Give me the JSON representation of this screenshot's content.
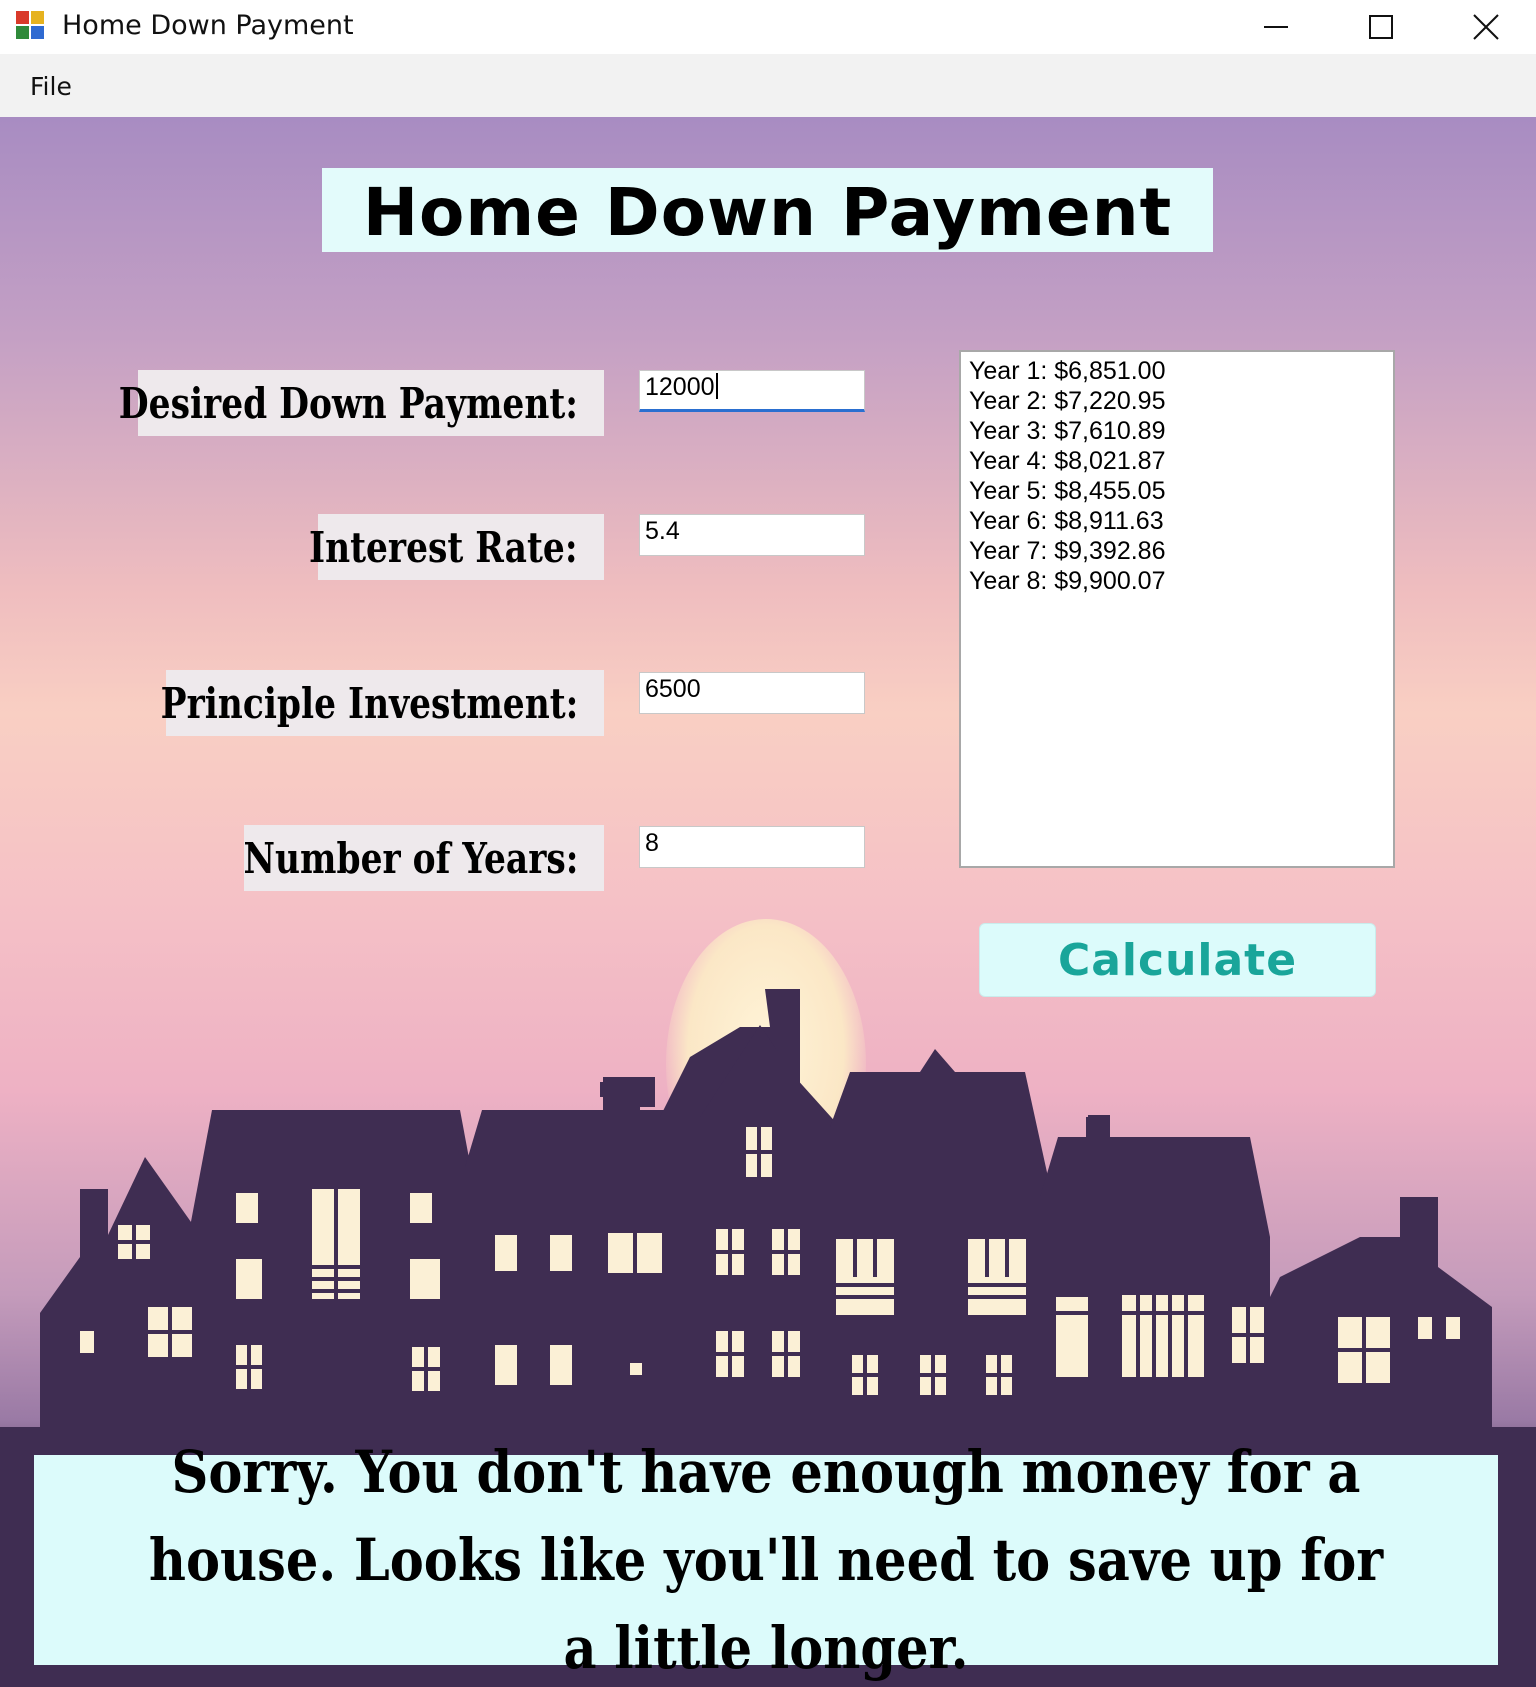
{
  "window": {
    "title": "Home Down Payment",
    "icon": "winforms-app-icon",
    "controls": [
      "minimize-icon",
      "maximize-icon",
      "close-icon"
    ]
  },
  "menu": {
    "items": [
      "File"
    ]
  },
  "form": {
    "title": "Home Down Payment",
    "fields": [
      {
        "label": "Desired Down Payment:",
        "value": "12000"
      },
      {
        "label": "Interest Rate:",
        "value": "5.4"
      },
      {
        "label": "Principle Investment:",
        "value": "6500"
      },
      {
        "label": "Number of Years:",
        "value": "8"
      }
    ],
    "results": [
      "Year 1: $6,851.00",
      "Year 2: $7,220.95",
      "Year 3: $7,610.89",
      "Year 4: $8,021.87",
      "Year 5: $8,455.05",
      "Year 6: $8,911.63",
      "Year 7: $9,392.86",
      "Year 8: $9,900.07"
    ],
    "calculate_label": "Calculate",
    "message": "Sorry. You don't have enough money for a house. Looks like you'll need to save up for a little longer."
  },
  "colors": {
    "title_bg": "#e3fbfb",
    "button_text": "#19a59a",
    "skyline": "#3f2d52",
    "window_light": "#fbf0d6"
  }
}
